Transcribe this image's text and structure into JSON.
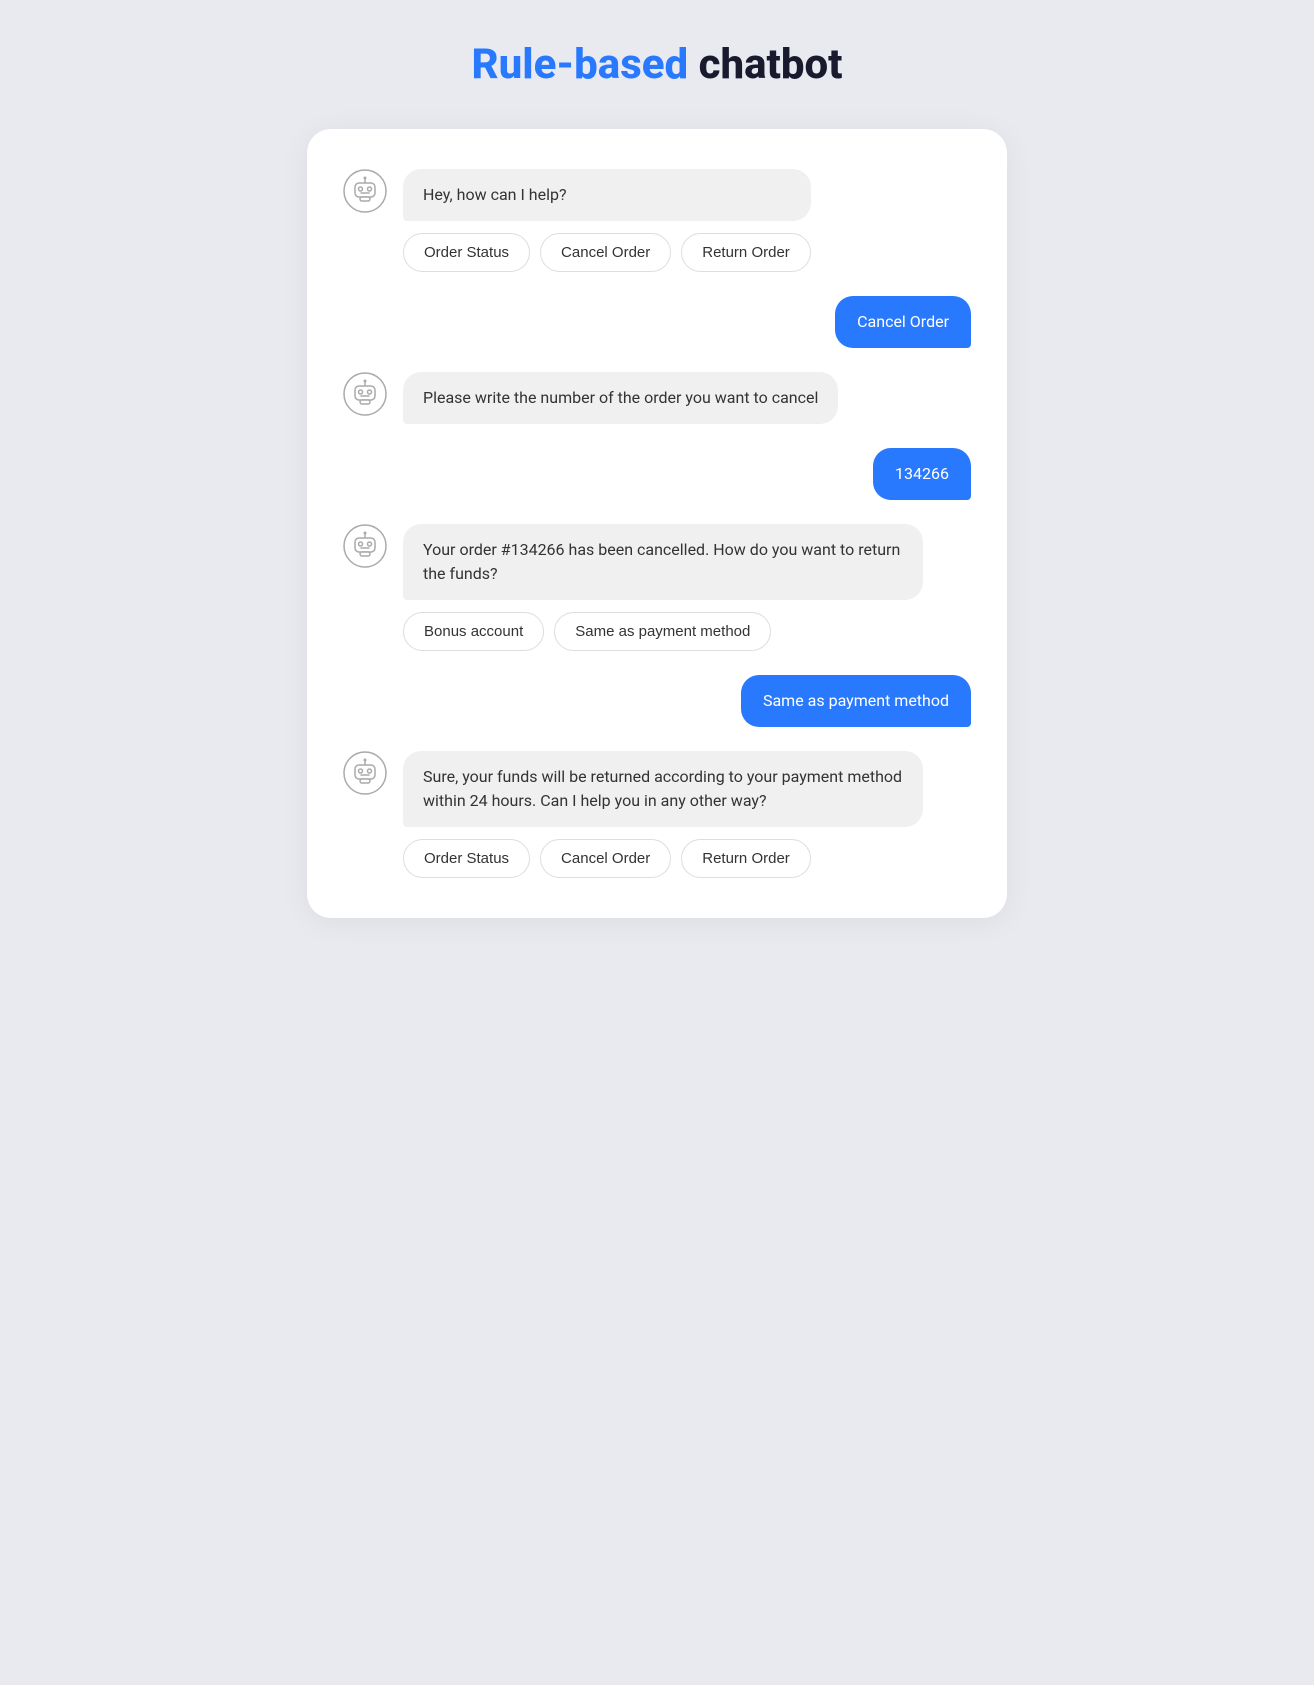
{
  "page": {
    "title_highlight": "Rule-based",
    "title_normal": "chatbot"
  },
  "chat": {
    "messages": [
      {
        "id": "msg1",
        "type": "bot",
        "text": "Hey, how can I help?",
        "quick_replies": [
          "Order Status",
          "Cancel Order",
          "Return Order"
        ]
      },
      {
        "id": "msg2",
        "type": "user",
        "text": "Cancel Order"
      },
      {
        "id": "msg3",
        "type": "bot",
        "text": "Please write the number of the order you want to cancel",
        "quick_replies": []
      },
      {
        "id": "msg4",
        "type": "user",
        "text": "134266"
      },
      {
        "id": "msg5",
        "type": "bot",
        "text": "Your order #134266 has been cancelled. How do you want to return the funds?",
        "quick_replies": [
          "Bonus account",
          "Same as payment method"
        ]
      },
      {
        "id": "msg6",
        "type": "user",
        "text": "Same as payment method"
      },
      {
        "id": "msg7",
        "type": "bot",
        "text": "Sure, your funds will be returned according to your payment method within 24 hours. Can I help you in any other way?",
        "quick_replies": [
          "Order Status",
          "Cancel Order",
          "Return Order"
        ]
      }
    ]
  }
}
